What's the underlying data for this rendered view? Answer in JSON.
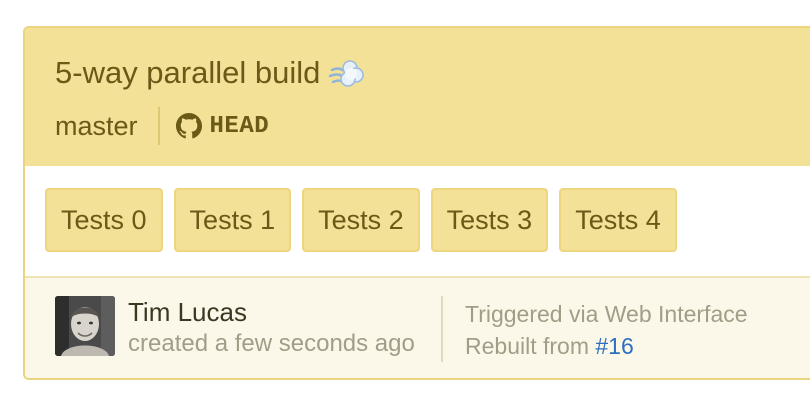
{
  "build": {
    "title": "5-way parallel build",
    "title_emoji": "dash-icon",
    "branch": "master",
    "commit": "HEAD",
    "commit_icon": "github-icon"
  },
  "jobs": [
    "Tests 0",
    "Tests 1",
    "Tests 2",
    "Tests 3",
    "Tests 4"
  ],
  "author": {
    "name": "Tim Lucas",
    "created": "created a few seconds ago"
  },
  "trigger": {
    "source": "Triggered via Web Interface",
    "rebuilt_prefix": "Rebuilt from",
    "rebuilt_link": "#16"
  },
  "colors": {
    "header_bg": "#f2e196",
    "job_bg": "#f2e196",
    "text": "#6a5a18",
    "link": "#2f6fc0"
  }
}
